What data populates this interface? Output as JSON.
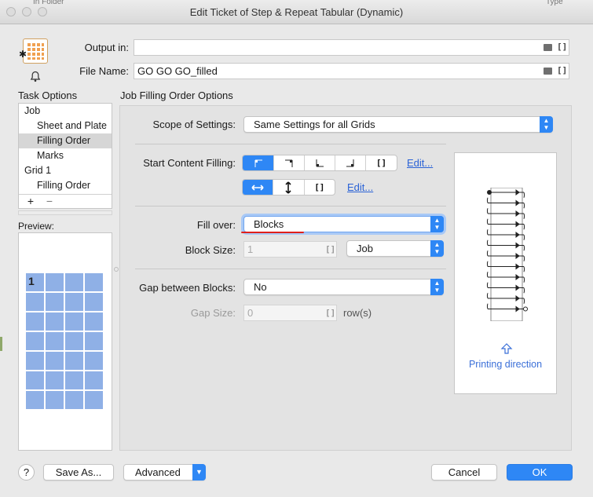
{
  "window": {
    "title": "Edit Ticket of Step & Repeat Tabular (Dynamic)"
  },
  "background": {
    "left_fragment": "In Folder",
    "right_fragment": "Type"
  },
  "header": {
    "output_label": "Output in:",
    "output_value": "",
    "filename_label": "File Name:",
    "filename_value": "GO GO GO_filled",
    "bracket": "[]"
  },
  "sidebar": {
    "task_options_title": "Task Options",
    "items": [
      {
        "label": "Job"
      },
      {
        "label": "Sheet and Plate"
      },
      {
        "label": "Filling Order"
      },
      {
        "label": "Marks"
      },
      {
        "label": "Grid 1"
      },
      {
        "label": "Filling Order"
      }
    ],
    "add": "+",
    "remove": "−",
    "preview_title": "Preview:",
    "preview_number": "1"
  },
  "main": {
    "section_title": "Job Filling Order Options",
    "scope_label": "Scope of Settings:",
    "scope_value": "Same Settings for all Grids",
    "start_label": "Start Content Filling:",
    "edit1": "Edit...",
    "edit2": "Edit...",
    "fill_over_label": "Fill over:",
    "fill_over_value": "Blocks",
    "block_size_label": "Block Size:",
    "block_size_value": "1",
    "block_unit_value": "Job",
    "gap_blocks_label": "Gap between Blocks:",
    "gap_blocks_value": "No",
    "gap_size_label": "Gap Size:",
    "gap_size_value": "0",
    "gap_unit": "row(s)",
    "printing_direction": "Printing direction"
  },
  "footer": {
    "help": "?",
    "save_as": "Save As...",
    "advanced": "Advanced",
    "cancel": "Cancel",
    "ok": "OK"
  },
  "colors": {
    "accent": "#2e87f5",
    "highlight_underline": "#e0201b",
    "preview_cell": "#8fb0e6"
  }
}
